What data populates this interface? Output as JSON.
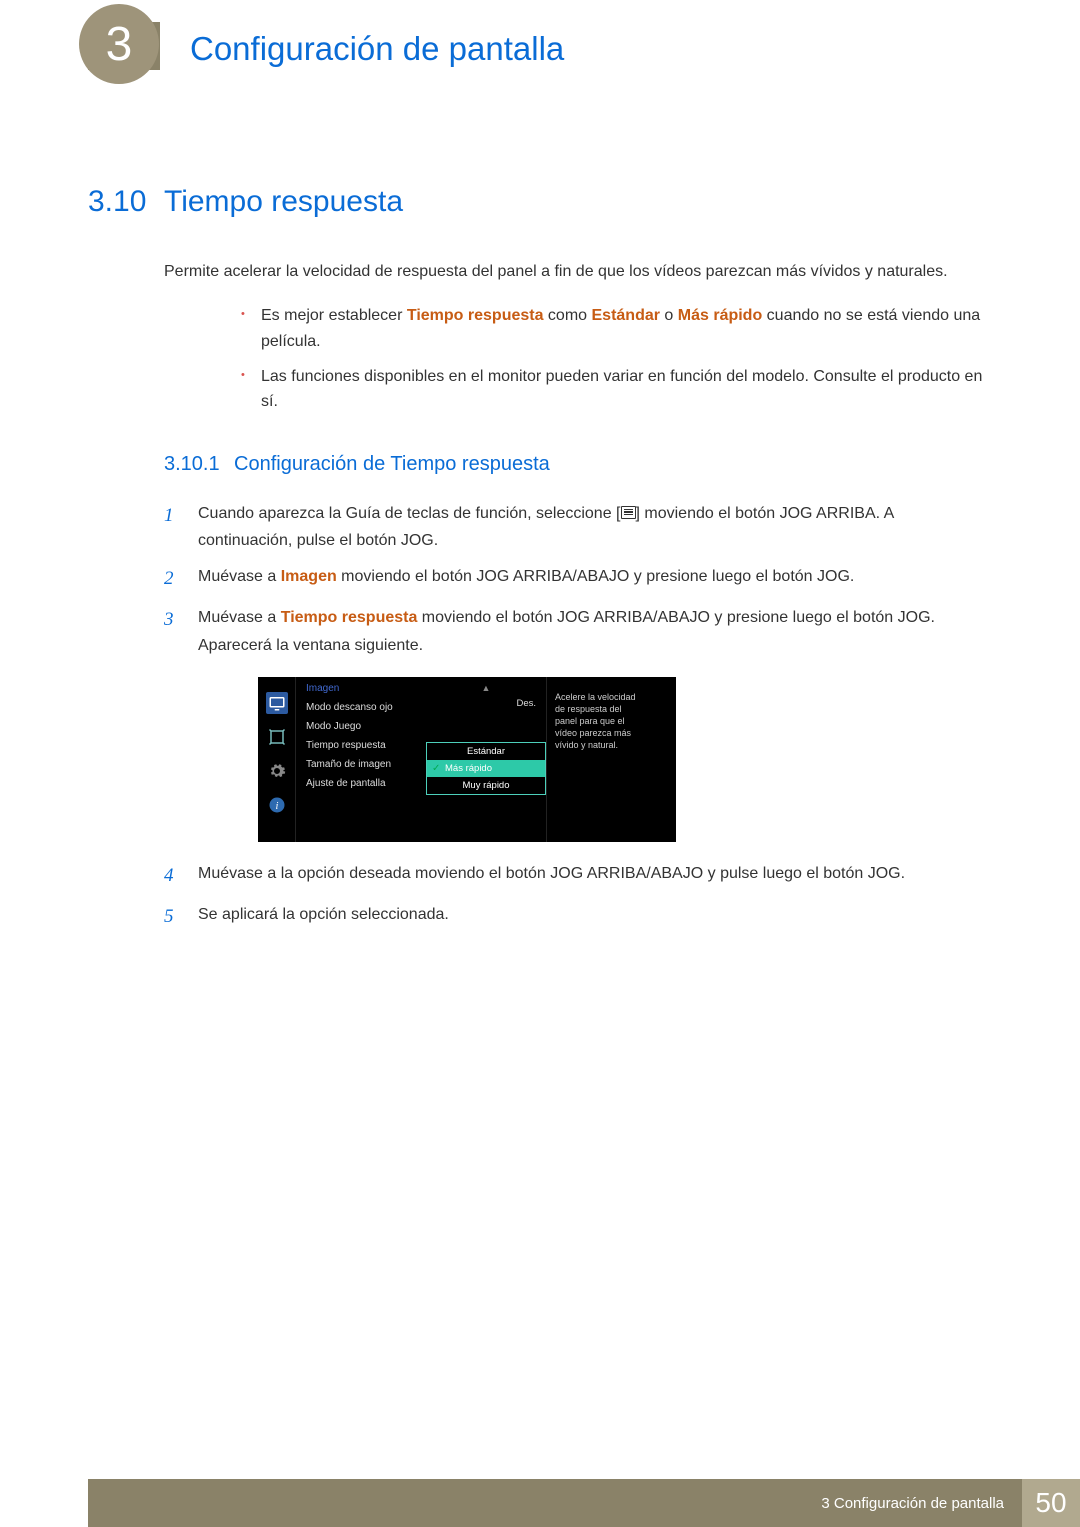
{
  "header": {
    "chapter_number": "3",
    "chapter_title": "Configuración de pantalla"
  },
  "section": {
    "number": "3.10",
    "title": "Tiempo respuesta",
    "intro": "Permite acelerar la velocidad de respuesta del panel a fin de que los vídeos parezcan más vívidos y naturales."
  },
  "notes": {
    "b1_a": "Es mejor establecer ",
    "b1_bold1": "Tiempo respuesta",
    "b1_b": " como ",
    "b1_bold2": "Estándar",
    "b1_c": " o ",
    "b1_bold3": "Más rápido",
    "b1_d": " cuando no se está viendo una película.",
    "b2": "Las funciones disponibles en el monitor pueden variar en función del modelo. Consulte el producto en sí."
  },
  "subsection": {
    "number": "3.10.1",
    "title": "Configuración de Tiempo respuesta"
  },
  "steps": {
    "s1a": "Cuando aparezca la Guía de teclas de función, seleccione [",
    "s1b": "] moviendo el botón JOG ARRIBA. A continuación, pulse el botón JOG.",
    "s2a": "Muévase a ",
    "s2bold": "Imagen",
    "s2b": " moviendo el botón JOG ARRIBA/ABAJO y presione luego el botón JOG.",
    "s3a": "Muévase a ",
    "s3bold": "Tiempo respuesta",
    "s3b": " moviendo el botón JOG ARRIBA/ABAJO y presione luego el botón JOG. Aparecerá la ventana siguiente.",
    "s4": "Muévase a la opción deseada moviendo el botón JOG ARRIBA/ABAJO y pulse luego el botón JOG.",
    "s5": "Se aplicará la opción seleccionada."
  },
  "osd": {
    "category": "Imagen",
    "rows": {
      "r1": "Modo descanso ojo",
      "r2": "Modo Juego",
      "r3": "Tiempo respuesta",
      "r4": "Tamaño de imagen",
      "r5": "Ajuste de pantalla"
    },
    "val_des": "Des.",
    "options": {
      "o1": "Estándar",
      "o2": "Más rápido",
      "o3": "Muy rápido"
    },
    "help": "Acelere la velocidad de respuesta del panel para que el vídeo parezca más vívido y natural."
  },
  "footer": {
    "chapter_label": "3 Configuración de pantalla",
    "page": "50"
  }
}
